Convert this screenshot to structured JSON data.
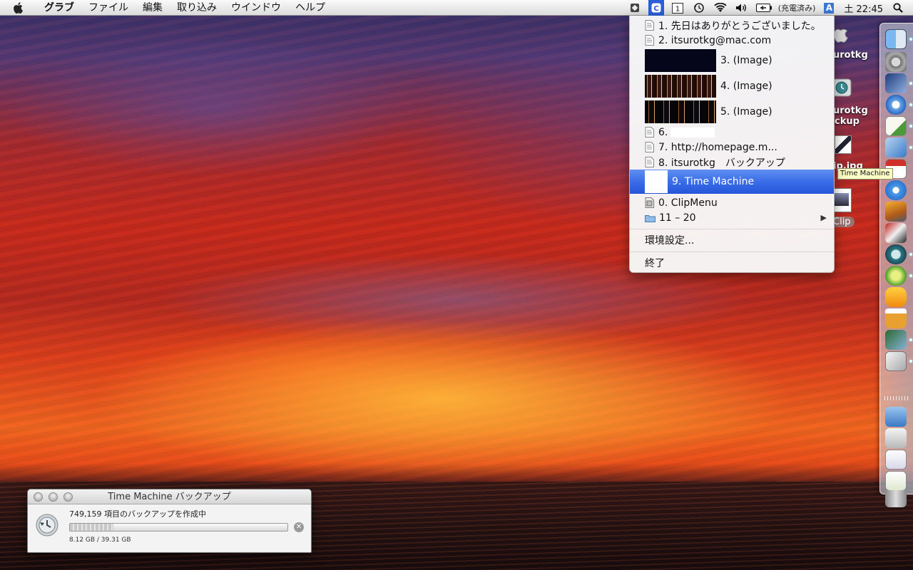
{
  "menubar": {
    "app_name": "グラブ",
    "items": [
      "ファイル",
      "編集",
      "取り込み",
      "ウインドウ",
      "ヘルプ"
    ],
    "battery_text": "(充電済み)",
    "input_mode": "A",
    "clock": "土 22:45"
  },
  "clipmenu": {
    "items": [
      {
        "label": "1. 先日はありがとうございました。",
        "kind": "text"
      },
      {
        "label": "2. itsurotkg@mac.com",
        "kind": "text"
      },
      {
        "label": "3. (Image)",
        "kind": "image"
      },
      {
        "label": "4. (Image)",
        "kind": "image"
      },
      {
        "label": "5. (Image)",
        "kind": "image"
      },
      {
        "label": "6.",
        "kind": "text"
      },
      {
        "label": "7. http://homepage.m...",
        "kind": "text"
      },
      {
        "label": "8. itsurotkg　バックアップ",
        "kind": "text"
      },
      {
        "label": "9. Time Machine",
        "kind": "image",
        "selected": true
      },
      {
        "label": "0. ClipMenu",
        "kind": "app"
      }
    ],
    "submenu_label": "11 – 20",
    "preferences_label": "環境設定...",
    "quit_label": "終了"
  },
  "desktop_icons": {
    "icon1_label": "urotkg",
    "icon2_label_line1": "urotkg",
    "icon2_label_line2": "ckup",
    "icon3_label": "ip.jpg",
    "icon4_label": "Clip"
  },
  "tooltip": {
    "text": "Time Machine"
  },
  "tm_window": {
    "title": "Time Machine バックアップ",
    "status": "749,159 項目のバックアップを作成中",
    "progress": 0.2,
    "size_text": "8.12 GB / 39.31 GB"
  },
  "colors": {
    "selection": "#3a6de8",
    "menubar": "#e9e9e9",
    "tooltip": "#ffffc8"
  }
}
